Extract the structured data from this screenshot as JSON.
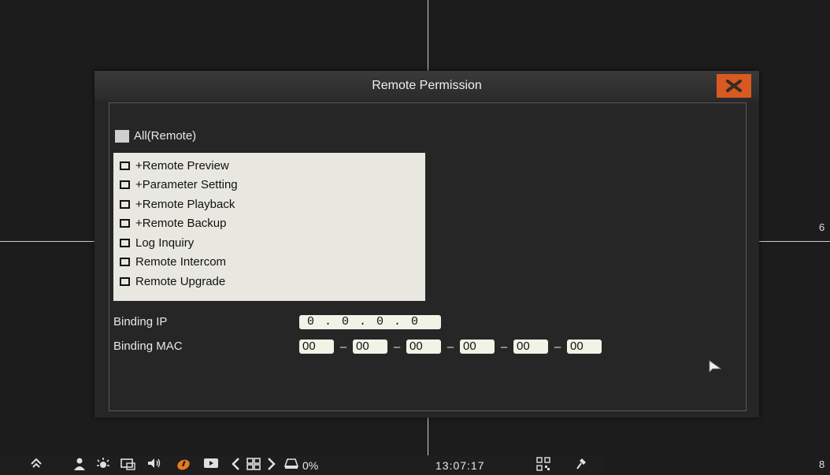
{
  "dialog": {
    "title": "Remote Permission",
    "all_label": "All(Remote)",
    "permissions": [
      "+Remote Preview",
      "+Parameter Setting",
      "+Remote Playback",
      "+Remote Backup",
      "Log Inquiry",
      "Remote Intercom",
      "Remote Upgrade"
    ],
    "binding_ip_label": "Binding IP",
    "binding_ip_value": "0 . 0 . 0 . 0",
    "binding_mac_label": "Binding MAC",
    "mac_segments": [
      "00",
      "00",
      "00",
      "00",
      "00",
      "00"
    ],
    "mac_separator": "–"
  },
  "channels": {
    "right_mid": "6",
    "right_bottom": "8"
  },
  "taskbar": {
    "hdd_usage": "0%",
    "clock": "13:07:17"
  },
  "colors": {
    "close_button": "#d85a22",
    "list_background": "#e8e8e0"
  }
}
